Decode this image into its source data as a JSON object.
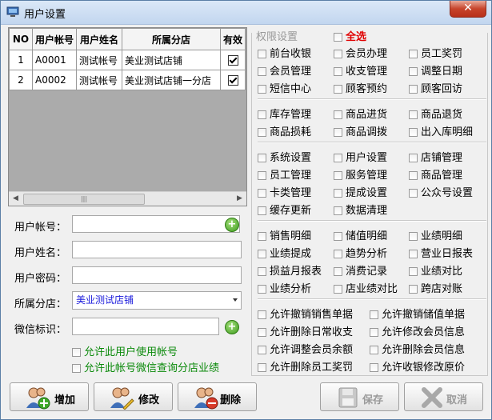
{
  "window": {
    "title": "用户设置",
    "close_glyph": "✕"
  },
  "grid": {
    "columns": [
      "NO",
      "用户帐号",
      "用户姓名",
      "所属分店",
      "有效"
    ],
    "rows": [
      {
        "no": "1",
        "account": "A0001",
        "name": "测试帐号",
        "store": "美业测试店铺",
        "valid": true
      },
      {
        "no": "2",
        "account": "A0002",
        "name": "测试帐号",
        "store": "美业测试店铺一分店",
        "valid": true
      }
    ]
  },
  "form": {
    "account_label": "用户帐号：",
    "name_label": "用户姓名：",
    "password_label": "用户密码：",
    "store_label": "所属分店：",
    "store_value": "美业测试店铺",
    "wechat_label": "微信标识：",
    "opt_allow_account": "允许此用户使用帐号",
    "opt_allow_wechat": "允许此帐号微信查询分店业绩"
  },
  "permissions": {
    "legend": "权限设置",
    "select_all": "全选",
    "group1": [
      "前台收银",
      "会员办理",
      "员工奖罚",
      "会员管理",
      "收支管理",
      "调整日期",
      "短信中心",
      "顾客预约",
      "顾客回访"
    ],
    "group2": [
      "库存管理",
      "商品进货",
      "商品退货",
      "商品损耗",
      "商品调拨",
      "出入库明细"
    ],
    "group3": [
      "系统设置",
      "用户设置",
      "店铺管理",
      "员工管理",
      "服务管理",
      "商品管理",
      "卡类管理",
      "提成设置",
      "公众号设置",
      "缓存更新",
      "数据清理"
    ],
    "group4": [
      "销售明细",
      "储值明细",
      "业绩明细",
      "业绩提成",
      "趋势分析",
      "营业日报表",
      "损益月报表",
      "消费记录",
      "业绩对比",
      "业绩分析",
      "店业绩对比",
      "跨店对账"
    ],
    "group5": [
      "允许撤销销售单据",
      "允许撤销储值单据",
      "允许删除日常收支",
      "允许修改会员信息",
      "允许调整会员余额",
      "允许删除会员信息",
      "允许删除员工奖罚",
      "允许收银修改原价"
    ]
  },
  "buttons": {
    "add": "增加",
    "edit": "修改",
    "delete": "删除",
    "save": "保存",
    "cancel": "取消"
  }
}
